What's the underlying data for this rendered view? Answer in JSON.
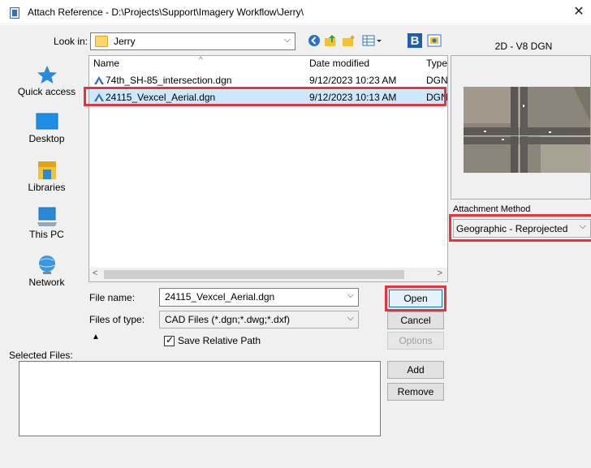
{
  "window": {
    "title": "Attach Reference - D:\\Projects\\Support\\Imagery Workflow\\Jerry\\",
    "close_glyph": "✕"
  },
  "lookin": {
    "label": "Look in:",
    "value": "Jerry"
  },
  "places": [
    {
      "label": "Quick access",
      "icon": "star-icon"
    },
    {
      "label": "Desktop",
      "icon": "desktop-icon"
    },
    {
      "label": "Libraries",
      "icon": "libraries-icon"
    },
    {
      "label": "This PC",
      "icon": "computer-icon"
    },
    {
      "label": "Network",
      "icon": "network-icon"
    }
  ],
  "filelist": {
    "columns": [
      "Name",
      "Date modified",
      "Type"
    ],
    "rows": [
      {
        "name": "74th_SH-85_intersection.dgn",
        "date": "9/12/2023 10:23 AM",
        "type": "DGN",
        "selected": false
      },
      {
        "name": "24115_Vexcel_Aerial.dgn",
        "date": "9/12/2023 10:13 AM",
        "type": "DGN",
        "selected": true
      }
    ]
  },
  "form": {
    "filename_label": "File name:",
    "filename_value": "24115_Vexcel_Aerial.dgn",
    "filetype_label": "Files of type:",
    "filetype_value": "CAD Files (*.dgn;*.dwg;*.dxf)",
    "save_relative_label": "Save Relative Path",
    "save_relative_checked": true,
    "selected_files_label": "Selected Files:"
  },
  "buttons": {
    "open": "Open",
    "cancel": "Cancel",
    "options": "Options",
    "add": "Add",
    "remove": "Remove"
  },
  "preview": {
    "label": "2D - V8 DGN",
    "attachment_method_label": "Attachment Method",
    "attachment_method_value": "Geographic - Reprojected"
  },
  "colors": {
    "highlight": "#e8323e",
    "selection": "#cce8ff",
    "accent": "#0078d7"
  }
}
